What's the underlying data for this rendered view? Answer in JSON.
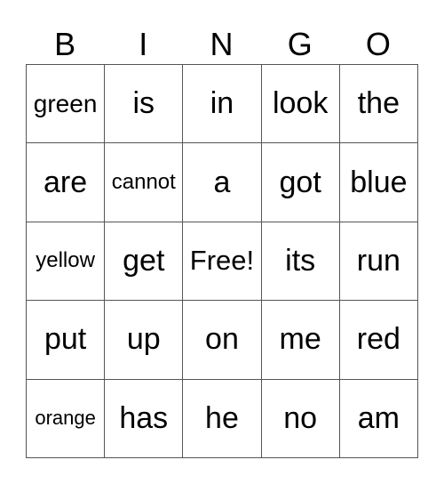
{
  "header": [
    "B",
    "I",
    "N",
    "G",
    "O"
  ],
  "rows": [
    [
      "green",
      "is",
      "in",
      "look",
      "the"
    ],
    [
      "are",
      "cannot",
      "a",
      "got",
      "blue"
    ],
    [
      "yellow",
      "get",
      "Free!",
      "its",
      "run"
    ],
    [
      "put",
      "up",
      "on",
      "me",
      "red"
    ],
    [
      "orange",
      "has",
      "he",
      "no",
      "am"
    ]
  ]
}
